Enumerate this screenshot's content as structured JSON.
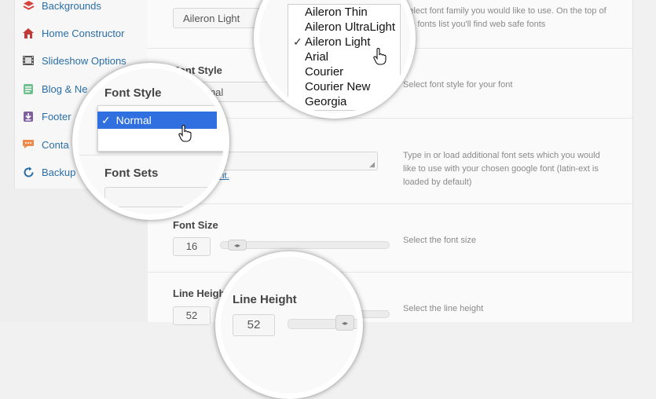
{
  "sidebar": {
    "items": [
      {
        "label": "Backgrounds",
        "icon": "layers-icon"
      },
      {
        "label": "Home Constructor",
        "icon": "house-icon"
      },
      {
        "label": "Slideshow Options",
        "icon": "film-icon"
      },
      {
        "label": "Blog & Ne",
        "icon": "document-icon"
      },
      {
        "label": "Footer",
        "icon": "download-icon"
      },
      {
        "label": "Conta",
        "icon": "speech-bubble-icon"
      },
      {
        "label": "Backup",
        "icon": "refresh-icon"
      }
    ]
  },
  "settings": {
    "font_family": {
      "value": "Aileron Light",
      "desc": "Select font family you would like to use. On the top of the fonts list you'll find web safe fonts"
    },
    "font_style": {
      "label": "Font Style",
      "value": "rmal",
      "desc": "Select font style for your font"
    },
    "font_sets": {
      "link": "m font.",
      "desc": "Type in or load additional font sets which you would like to use with your chosen google font (latin-ext is loaded by default)"
    },
    "font_size": {
      "label": "Font Size",
      "value": "16",
      "desc": "Select the font size",
      "level": 0
    },
    "line_height": {
      "label": "Line Heigh",
      "value": "52",
      "desc": "Select the line height"
    }
  },
  "zoom_family": {
    "options": [
      "Aileron Thin",
      "Aileron UltraLight",
      "Aileron Light",
      "Arial",
      "Courier",
      "Courier New",
      "Georgia"
    ],
    "selected_index": 2,
    "check": "✓"
  },
  "zoom_style": {
    "label": "Font Style",
    "selected": "Normal",
    "check": "✓",
    "sets_label": "Font Sets"
  },
  "zoom_line": {
    "label": "Line Height",
    "value": "52"
  },
  "colors": {
    "link": "#2a6ea6",
    "selection": "#2f6fe0",
    "accent_red": "#d9423a"
  }
}
